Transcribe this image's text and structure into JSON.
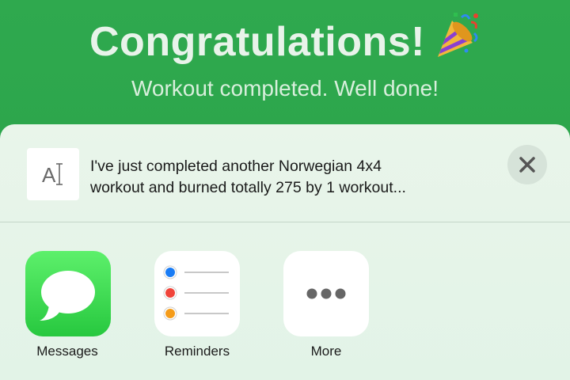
{
  "header": {
    "title": "Congratulations!",
    "title_icon": "party-popper-emoji",
    "subtitle": "Workout completed. Well done!"
  },
  "share_preview": {
    "thumbnail_icon": "text-format-icon",
    "thumbnail_glyph": "A",
    "text_line1": "I've just completed another Norwegian 4x4",
    "text_line2": "workout and burned totally 275 by 1 workout..."
  },
  "close_icon": "x-mark-icon",
  "apps": [
    {
      "label": "Messages",
      "icon": "messages-icon"
    },
    {
      "label": "Reminders",
      "icon": "reminders-icon"
    },
    {
      "label": "More",
      "icon": "ellipsis-icon"
    }
  ],
  "colors": {
    "header_green": "#2fa94e",
    "sheet_bg": "#e6f4e9",
    "messages_green": "#34d14a",
    "reminder_blue": "#1a7cf5",
    "reminder_red": "#f0443a",
    "reminder_orange": "#f59c1a"
  }
}
